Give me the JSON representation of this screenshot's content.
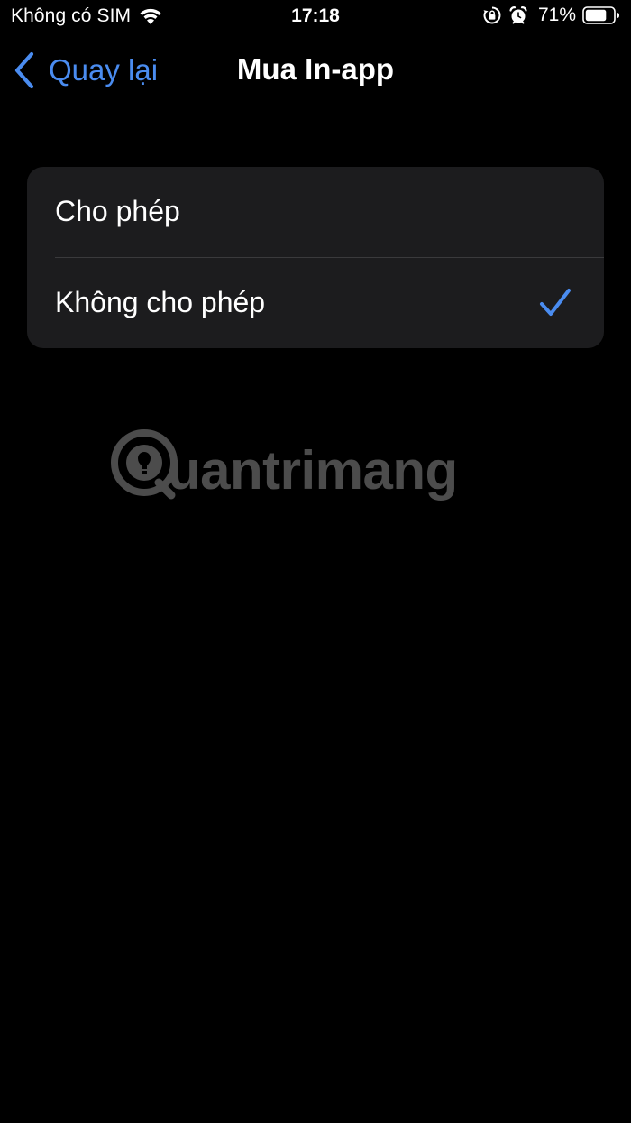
{
  "status_bar": {
    "carrier": "Không có SIM",
    "time": "17:18",
    "battery_percent": "71%",
    "icons": [
      "wifi-icon",
      "rotation-lock-icon",
      "alarm-icon",
      "battery-icon"
    ]
  },
  "nav": {
    "back_label": "Quay lại",
    "title": "Mua In-app"
  },
  "options": {
    "items": [
      {
        "label": "Cho phép",
        "selected": false
      },
      {
        "label": "Không cho phép",
        "selected": true
      }
    ]
  },
  "watermark": {
    "text": "uantrimang"
  },
  "colors": {
    "background": "#000000",
    "group_background": "#1c1c1e",
    "accent": "#4a8cf0",
    "separator": "#3a3a3c",
    "text": "#ffffff"
  }
}
